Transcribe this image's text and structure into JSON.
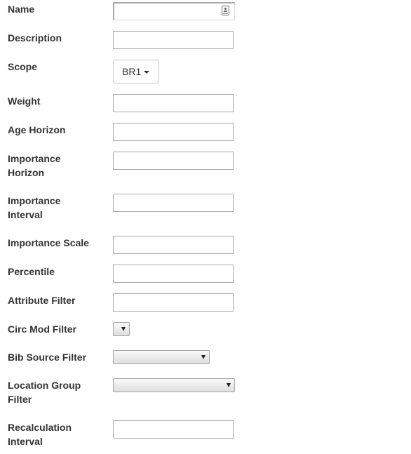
{
  "form": {
    "fields": {
      "name": {
        "label": "Name",
        "value": ""
      },
      "description": {
        "label": "Description",
        "value": ""
      },
      "scope": {
        "label": "Scope",
        "selected": "BR1"
      },
      "weight": {
        "label": "Weight",
        "value": ""
      },
      "age_horizon": {
        "label": "Age Horizon",
        "value": ""
      },
      "importance_horizon": {
        "label": "Importance Horizon",
        "value": ""
      },
      "importance_interval": {
        "label": "Importance Interval",
        "value": ""
      },
      "importance_scale": {
        "label": "Importance Scale",
        "value": ""
      },
      "percentile": {
        "label": "Percentile",
        "value": ""
      },
      "attribute_filter": {
        "label": "Attribute Filter",
        "value": ""
      },
      "circ_mod_filter": {
        "label": "Circ Mod Filter",
        "selected": ""
      },
      "bib_source_filter": {
        "label": "Bib Source Filter",
        "selected": ""
      },
      "location_group_filter": {
        "label": "Location Group Filter",
        "selected": ""
      },
      "recalculation_interval": {
        "label": "Recalculation Interval",
        "value": ""
      }
    }
  },
  "icons": {
    "name_field_icon": "contact-card-icon",
    "scope_caret": "caret-down-icon",
    "select_arrow": "triangle-down-icon"
  },
  "colors": {
    "label_text": "#333333",
    "input_border": "#a9a9a9",
    "button_border": "#cccccc"
  }
}
